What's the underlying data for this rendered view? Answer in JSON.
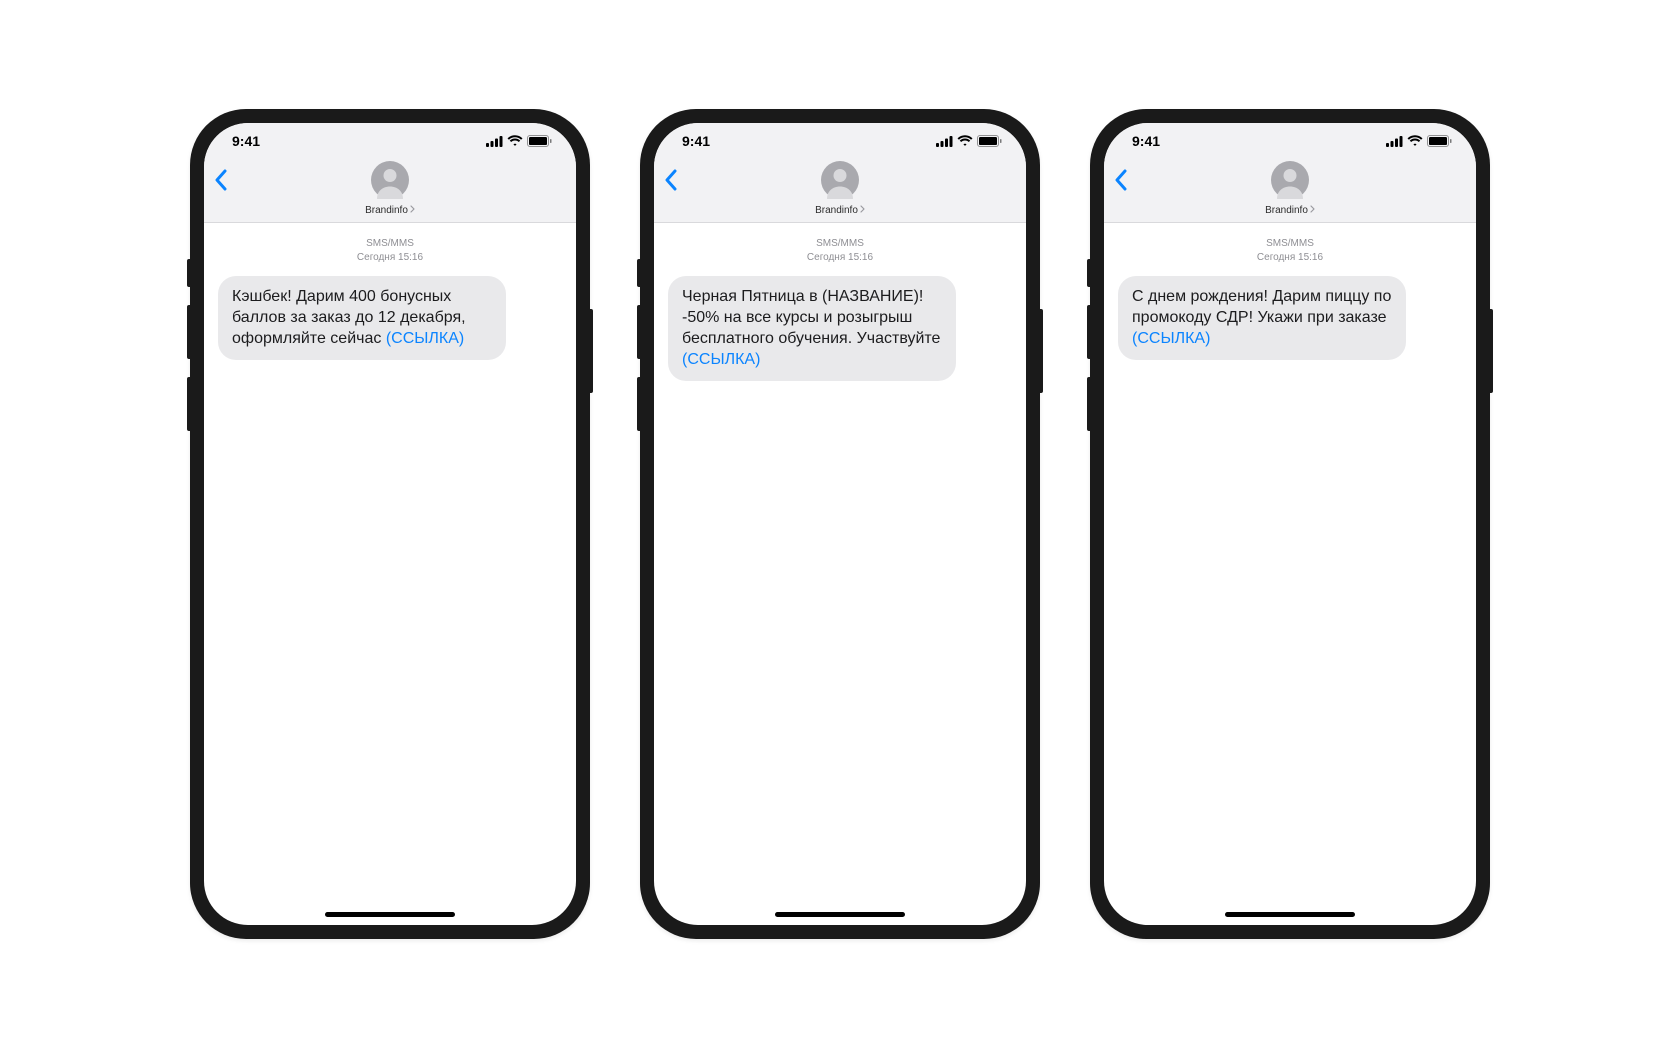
{
  "status": {
    "time": "9:41"
  },
  "nav": {
    "contact_name": "Brandinfo"
  },
  "thread_meta": {
    "type_label": "SMS/MMS",
    "timestamp": "Сегодня 15:16"
  },
  "phones": [
    {
      "message_text": "Кэшбек! Дарим 400 бонусных баллов за заказ до 12 декабря, оформляйте сейчас ",
      "message_link": "(ССЫЛКА)"
    },
    {
      "message_text": "Черная Пятница в (НАЗВАНИЕ)! -50% на все курсы и розыгрыш бесплатного обучения. Участвуйте ",
      "message_link": "(ССЫЛКА)"
    },
    {
      "message_text": "С днем рождения! Дарим пиццу по промокоду СДР! Укажи при заказе ",
      "message_link": "(ССЫЛКА)"
    }
  ]
}
